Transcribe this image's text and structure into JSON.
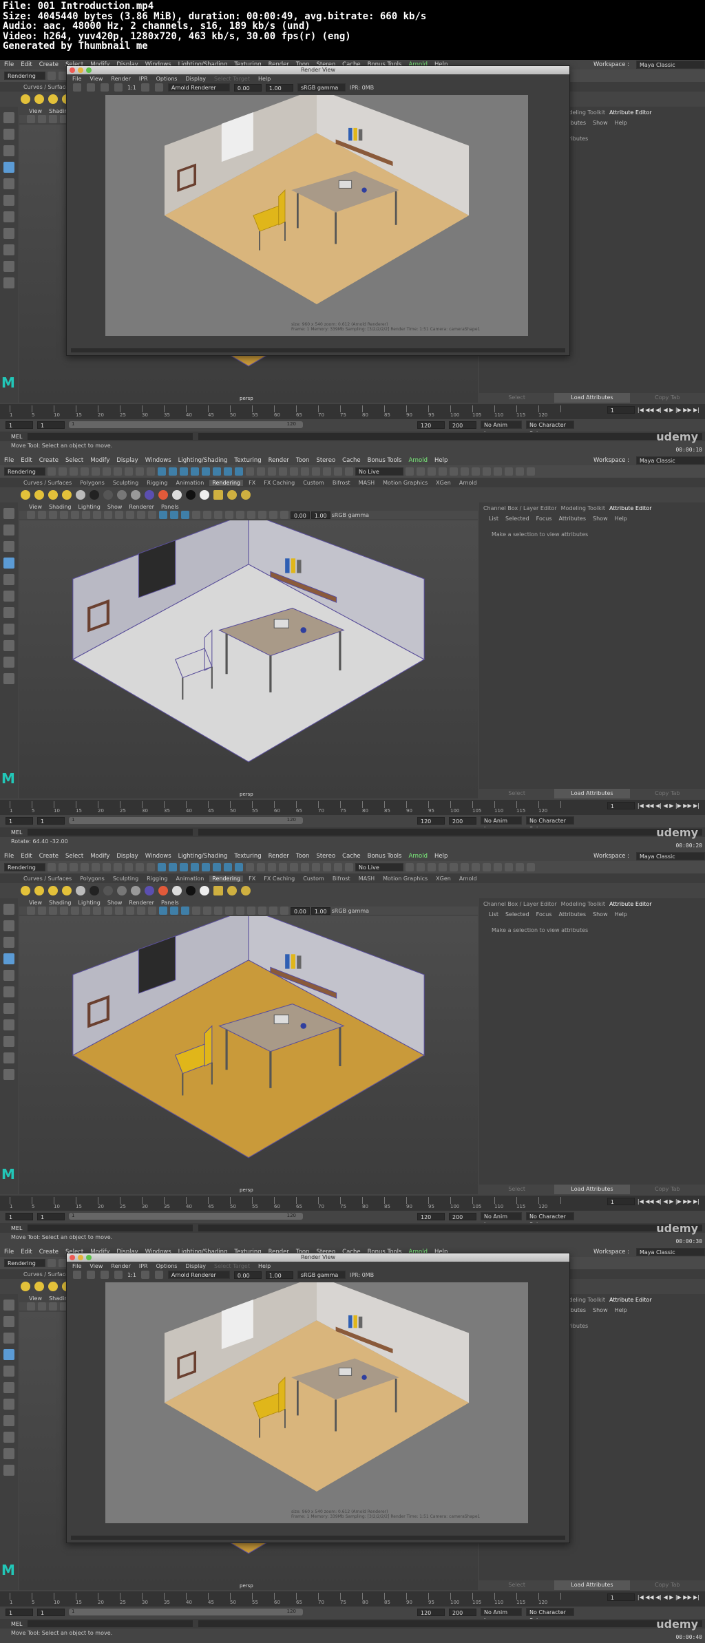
{
  "header": {
    "file": "File: 001 Introduction.mp4",
    "size": "Size: 4045440 bytes (3.86 MiB), duration: 00:00:49, avg.bitrate: 660 kb/s",
    "audio": "Audio: aac, 48000 Hz, 2 channels, s16, 189 kb/s (und)",
    "video": "Video: h264, yuv420p, 1280x720, 463 kb/s, 30.00 fps(r) (eng)",
    "generated": "Generated by Thumbnail me"
  },
  "maya": {
    "menus": [
      "File",
      "Edit",
      "Create",
      "Select",
      "Modify",
      "Display",
      "Windows",
      "Lighting/Shading",
      "Texturing",
      "Render",
      "Toon",
      "Stereo",
      "Cache",
      "Bonus Tools",
      "Arnold",
      "Help"
    ],
    "mode": "Rendering",
    "no_live": "No Live Surface",
    "workspace_label": "Workspace :",
    "workspace": "Maya Classic",
    "shelf_tabs": [
      "Curves / Surfaces",
      "Polygons",
      "Sculpting",
      "Rigging",
      "Animation",
      "Rendering",
      "FX",
      "FX Caching",
      "Custom",
      "Bifrost",
      "MASH",
      "Motion Graphics",
      "XGen",
      "Arnold"
    ],
    "panel_menus": [
      "View",
      "Shading",
      "Lighting",
      "Show",
      "Renderer",
      "Panels"
    ],
    "exposure": "0.00",
    "gamma": "1.00",
    "color_space": "sRGB gamma",
    "camera": "persp",
    "right_tabs": [
      "Channel Box / Layer Editor",
      "Modeling Toolkit",
      "Attribute Editor"
    ],
    "right_sub": [
      "List",
      "Selected",
      "Focus",
      "Attributes",
      "Show",
      "Help"
    ],
    "right_msg": "Make a selection to view attributes",
    "btn_select": "Select",
    "btn_load": "Load Attributes",
    "btn_copy": "Copy Tab",
    "tick_nums": [
      "1",
      "5",
      "10",
      "15",
      "20",
      "25",
      "30",
      "35",
      "40",
      "45",
      "50",
      "55",
      "60",
      "65",
      "70",
      "75",
      "80",
      "85",
      "90",
      "95",
      "100",
      "105",
      "110",
      "115",
      "120"
    ],
    "current_frame": "1",
    "range_start": "1",
    "range_start2": "1",
    "range_slider_start": "1",
    "range_slider_end": "120",
    "range_end": "120",
    "range_end2": "200",
    "anim_layer": "No Anim Layer",
    "char_set": "No Character Set",
    "mel": "MEL",
    "help_move": "Move Tool: Select an object to move.",
    "help_rotate": "Rotate: 64.40   -32.00",
    "udemy": "udemy",
    "render_view": {
      "title": "Render View",
      "menus": [
        "File",
        "View",
        "Render",
        "IPR",
        "Options",
        "Display",
        "Select Target",
        "Help"
      ],
      "renderer": "Arnold Renderer",
      "ratio": "1:1",
      "exposure": "0.00",
      "gamma": "1.00",
      "color": "sRGB gamma",
      "ipr": "IPR: 0MB",
      "caption": "size: 960 x 540 zoom: 0.612     (Arnold Renderer)",
      "caption2": "Frame: 1     Memory: 339Mb     Sampling: [3/2/2/2/2]     Render Time: 1:51     Camera: cameraShape1"
    }
  },
  "frames": [
    {
      "timestamp": "00:00:10"
    },
    {
      "timestamp": "00:00:20"
    },
    {
      "timestamp": "00:00:30"
    },
    {
      "timestamp": "00:00:40"
    }
  ]
}
